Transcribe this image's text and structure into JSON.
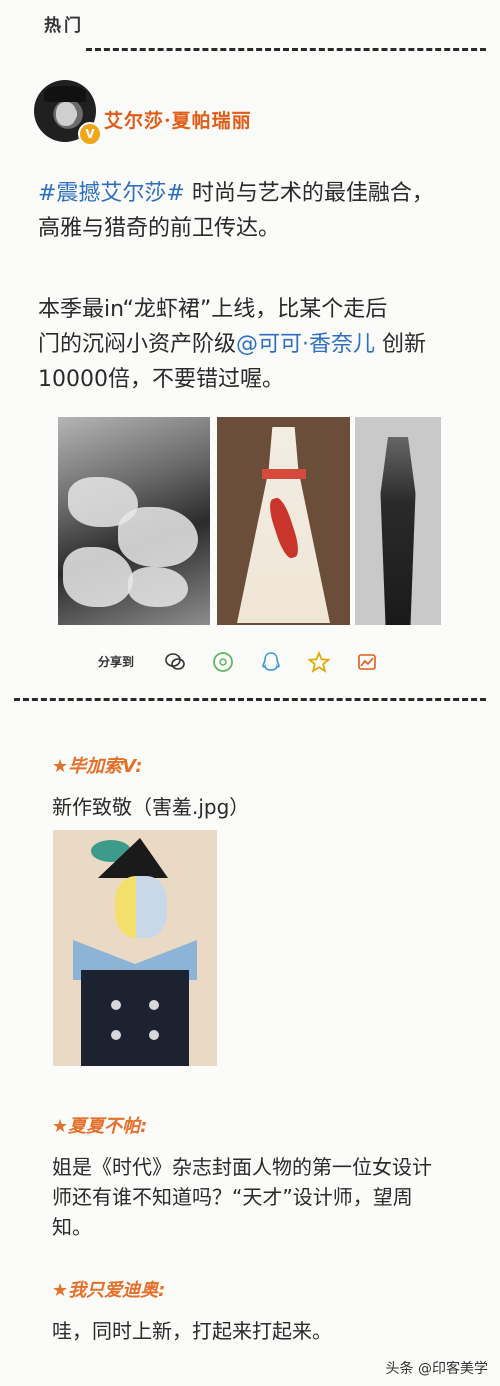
{
  "hot_tab": "热门",
  "post": {
    "author": "艾尔莎·夏帕瑞丽",
    "verified_badge": "V",
    "hashtag": "#震撼艾尔莎#",
    "para1_rest1": " 时尚与艺术的最佳融合，",
    "para1_line2": "高雅与猎奇的前卫传达。",
    "para2_line1": "本季最in“龙虾裙”上线，比某个走后",
    "para2_line2_pre": "门的沉闷小资产阶级",
    "mention": "@可可·香奈儿",
    "para2_line2_post": " 创新",
    "para2_line3": "10000倍，不要错过喔。"
  },
  "share": {
    "label": "分享到",
    "icons": [
      "wechat-icon",
      "moments-icon",
      "qq-icon",
      "favorite-star-icon",
      "weibo-icon"
    ]
  },
  "comments": [
    {
      "name": "★毕加索V:",
      "text": "新作致敬（害羞.jpg）"
    },
    {
      "name": "★夏夏不帕:",
      "text_line1": "姐是《时代》杂志封面人物的第一位女设计",
      "text_line2": "师还有谁不知道吗？“天才”设计师，望周",
      "text_line3": "知。"
    },
    {
      "name": "★我只爱迪奥:",
      "text": "哇，同时上新，打起来打起来。"
    }
  ],
  "watermark": "头条 @印客美学",
  "colors": {
    "accent_orange": "#e4702a",
    "link_blue": "#2d6fc0",
    "badge_yellow": "#f2a516"
  }
}
